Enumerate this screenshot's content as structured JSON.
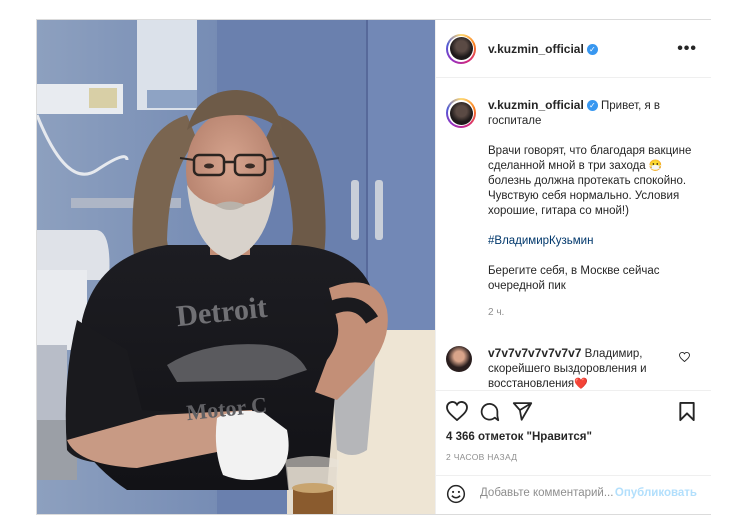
{
  "post": {
    "username": "v.kuzmin_official",
    "verified_icon": "verified-badge-icon",
    "more_icon": "more-options-icon",
    "caption": {
      "greeting": "Привет, я в госпитале",
      "p1_part1": "Врачи говорят, что благодаря вакцине сделанной мной в три захода",
      "p1_emoji": "😷",
      "p1_part2": "болезнь должна протекать спокойно.",
      "p1_line2": "Чувствую себя нормально. Условия хорошие, гитара со мной!)",
      "hashtag": "#ВладимирКузьмин",
      "p3": "Берегите себя, в Москве сейчас очередной пик",
      "time": "2 ч."
    },
    "comment": {
      "username": "v7v7v7v7v7v7v7",
      "text": "Владимир, скорейшего выздоровления и восстановления",
      "emoji": "❤️"
    },
    "likes": "4 366 отметок \"Нравится\"",
    "time_ago": "2 ЧАСОВ НАЗАД",
    "add_comment": {
      "placeholder": "Добавьте комментарий...",
      "post_label": "Опубликовать"
    },
    "colors": {
      "accent": "#3897f0",
      "post_button_disabled": "#b2dffc",
      "heart": "#ed4956"
    }
  }
}
